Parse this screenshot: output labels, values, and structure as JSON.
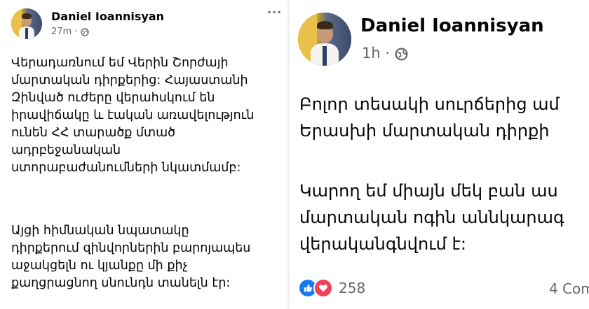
{
  "left_post": {
    "author": "Daniel Ioannisyan",
    "time": "27m",
    "separator": "·",
    "menu": "···",
    "paragraph1": [
      "Վերադառնում եմ Վերին Շորժայի",
      "մարտական դիրքերից: Հայաստանի",
      "Զինված ուժերը վերահսկում են",
      "իրավիճակը և էական առավելություն",
      "ունեն ՀՀ տարածք մտած",
      "ադրբեջանական",
      "ստորաբաժանումների նկատմամբ:"
    ],
    "paragraph2": [
      "Այցի հիմնական նպատակը",
      "դիրքերում զինվորներին բարոյապես",
      "աջակցելն ու կյանքը մի քիչ",
      "քաղցրացնող սնունդն տանելն էր:"
    ]
  },
  "right_post": {
    "author": "Daniel Ioannisyan",
    "time": "1h",
    "separator": "·",
    "paragraph1": [
      "Բոլոր տեսակի սուրճերից ամ",
      "Երասխի մարտական դիրքի"
    ],
    "paragraph2": [
      "Կարող եմ միայն մեկ բան աս",
      "մարտական ոգին աննկարագ",
      "վերականգնվում է:"
    ],
    "reaction_count": "258",
    "comments": "4 Com"
  },
  "colors": {
    "like_blue": "#1877f2",
    "love_red": "#f33e58",
    "secondary_text": "#65676b",
    "text": "#050505"
  },
  "icons": [
    "globe-icon",
    "more-options-icon",
    "like-reaction-icon",
    "love-reaction-icon"
  ]
}
